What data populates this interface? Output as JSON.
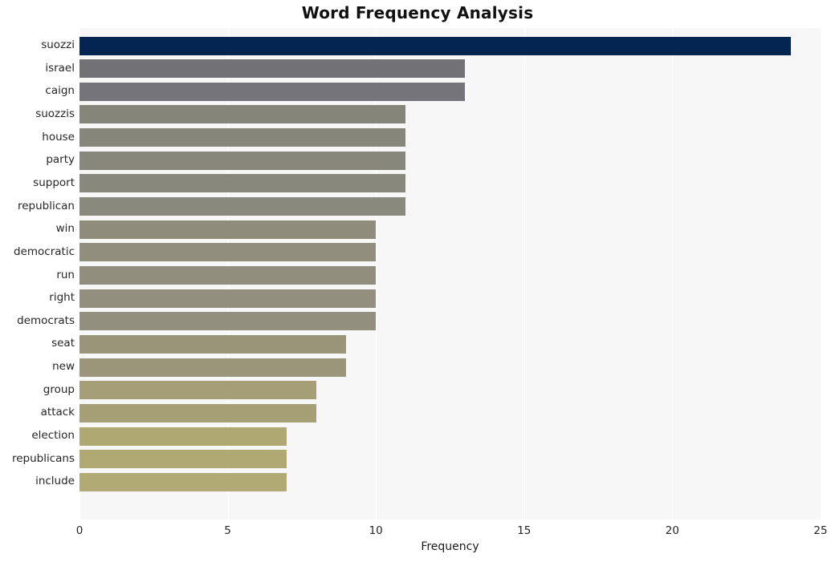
{
  "chart_data": {
    "type": "bar",
    "orientation": "horizontal",
    "title": "Word Frequency Analysis",
    "xlabel": "Frequency",
    "ylabel": "",
    "xlim": [
      0,
      25
    ],
    "ylim": null,
    "grid": true,
    "legend": null,
    "xticks": [
      "0",
      "5",
      "10",
      "15",
      "20",
      "25"
    ],
    "xtick_values": [
      0,
      5,
      10,
      15,
      20,
      25
    ],
    "categories": [
      "suozzi",
      "israel",
      "caign",
      "suozzis",
      "house",
      "party",
      "support",
      "republican",
      "win",
      "democratic",
      "run",
      "right",
      "democrats",
      "seat",
      "new",
      "group",
      "attack",
      "election",
      "republicans",
      "include"
    ],
    "values": [
      24,
      13,
      13,
      11,
      11,
      11,
      11,
      11,
      10,
      10,
      10,
      10,
      10,
      9,
      9,
      8,
      8,
      7,
      7,
      7
    ],
    "bar_colors": [
      "#042451",
      "#727276",
      "#74747a",
      "#85857a",
      "#86867b",
      "#87877b",
      "#88887c",
      "#89897d",
      "#8f8c7c",
      "#918e7d",
      "#918e7d",
      "#928f7e",
      "#938f7e",
      "#9a9579",
      "#9b9679",
      "#a59e76",
      "#a69f76",
      "#b0a873",
      "#b1a973",
      "#b2aa74"
    ],
    "plot_background": "#f7f7f7",
    "gridline_color": "#ffffff",
    "figure_background": "#ffffff"
  }
}
